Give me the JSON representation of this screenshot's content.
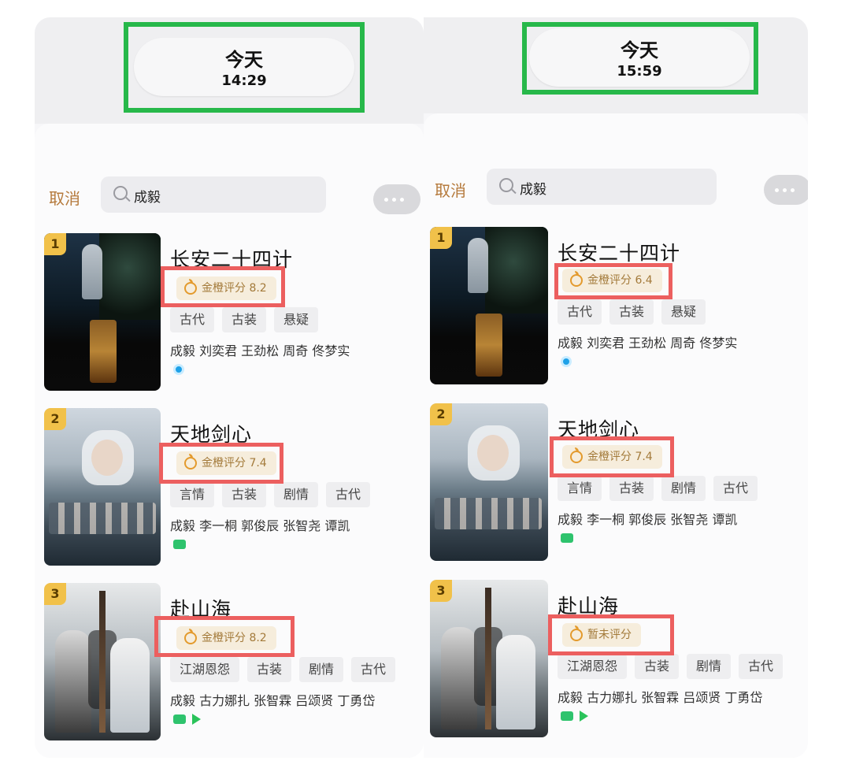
{
  "panels": [
    {
      "day": "今天",
      "time": "14:29",
      "cancel": "取消",
      "query": "成毅",
      "results": [
        {
          "rank": "1",
          "title": "长安二十四计",
          "rating": "金橙评分 8.2",
          "tags": [
            "古代",
            "古装",
            "悬疑"
          ],
          "cast": "成毅 刘奕君 王劲松 周奇 佟梦实",
          "sources": [
            "tencent-video-icon"
          ]
        },
        {
          "rank": "2",
          "title": "天地剑心",
          "rating": "金橙评分 7.4",
          "tags": [
            "言情",
            "古装",
            "剧情",
            "古代"
          ],
          "cast": "成毅 李一桐 郭俊辰 张智尧 谭凯",
          "sources": [
            "iqiyi-icon"
          ]
        },
        {
          "rank": "3",
          "title": "赴山海",
          "rating": "金橙评分 8.2",
          "tags": [
            "江湖恩怨",
            "古装",
            "剧情",
            "古代"
          ],
          "cast": "成毅 古力娜扎 张智霖 吕颂贤 丁勇岱",
          "sources": [
            "iqiyi-icon",
            "youku-icon"
          ]
        }
      ]
    },
    {
      "day": "今天",
      "time": "15:59",
      "cancel": "取消",
      "query": "成毅",
      "results": [
        {
          "rank": "1",
          "title": "长安二十四计",
          "rating": "金橙评分 6.4",
          "tags": [
            "古代",
            "古装",
            "悬疑"
          ],
          "cast": "成毅 刘奕君 王劲松 周奇 佟梦实",
          "sources": [
            "tencent-video-icon"
          ]
        },
        {
          "rank": "2",
          "title": "天地剑心",
          "rating": "金橙评分 7.4",
          "tags": [
            "言情",
            "古装",
            "剧情",
            "古代"
          ],
          "cast": "成毅 李一桐 郭俊辰 张智尧 谭凯",
          "sources": [
            "iqiyi-icon"
          ]
        },
        {
          "rank": "3",
          "title": "赴山海",
          "rating": "暂未评分",
          "tags": [
            "江湖恩怨",
            "古装",
            "剧情",
            "古代"
          ],
          "cast": "成毅 古力娜扎 张智霖 吕颂贤 丁勇岱",
          "sources": [
            "iqiyi-icon",
            "youku-icon"
          ]
        }
      ]
    }
  ],
  "colors": {
    "highlight_green": "#27b84a",
    "highlight_red": "#ec5f5f",
    "cancel_text": "#b57a3c",
    "rating_text": "#a37a3a"
  }
}
